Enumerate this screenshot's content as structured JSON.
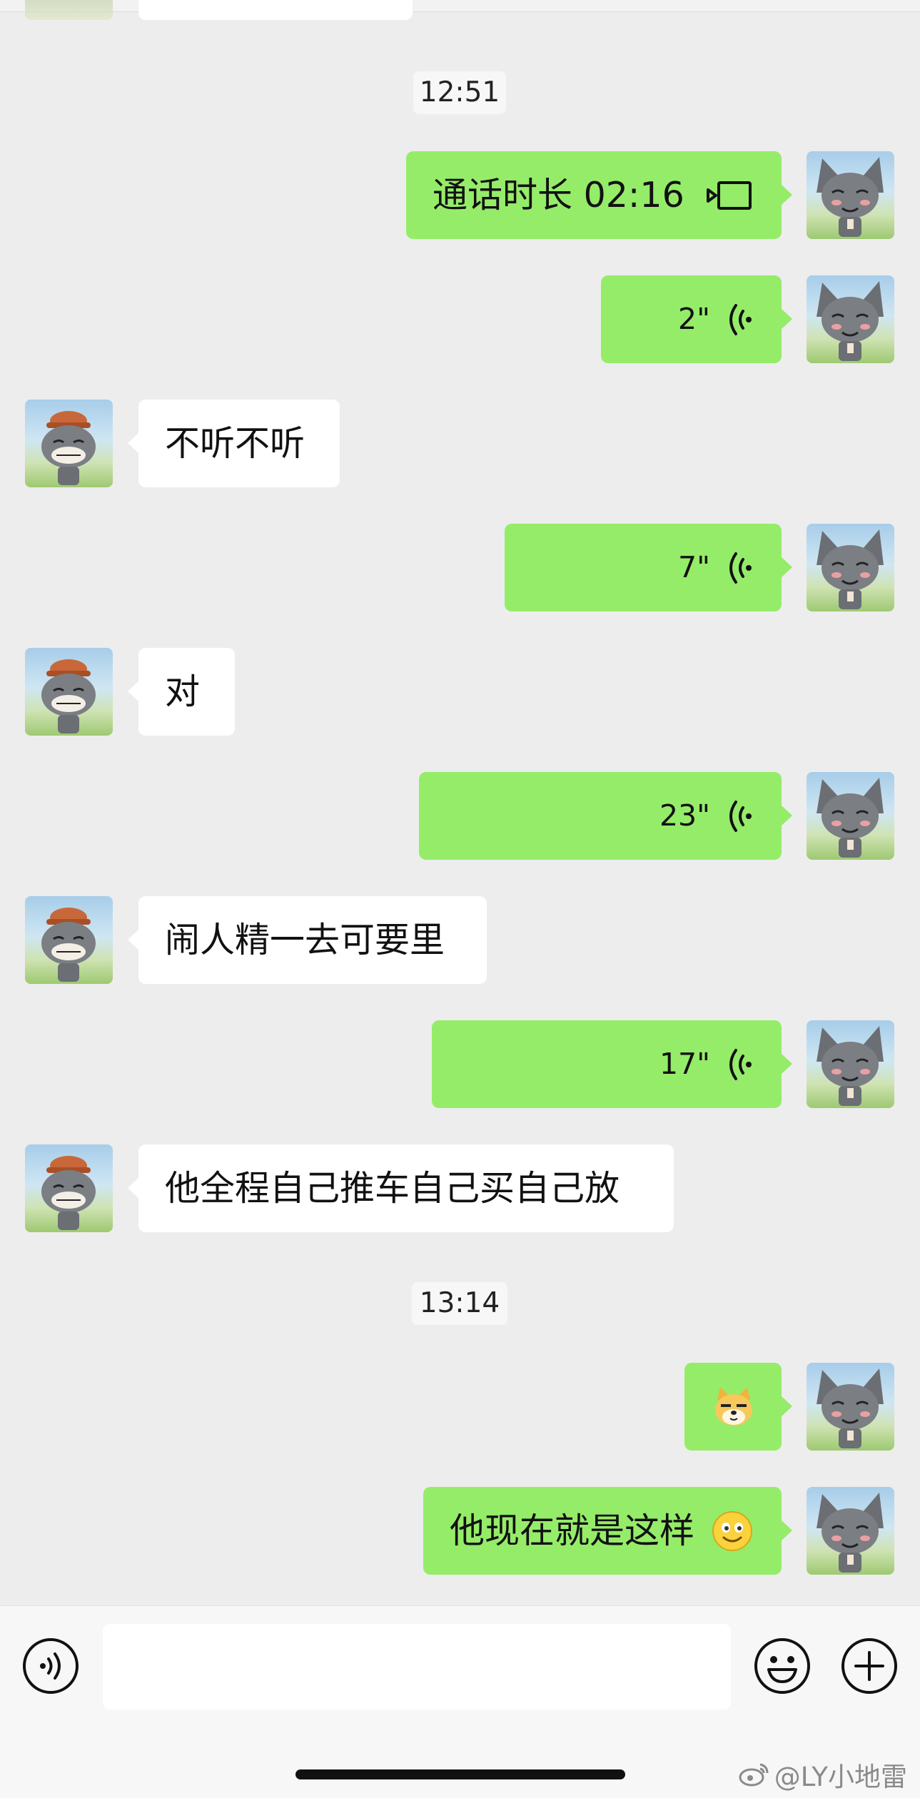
{
  "chat": {
    "timestamps": [
      "12:51",
      "13:14"
    ],
    "call": {
      "label": "通话时长 02:16",
      "icon": "video-call-icon"
    },
    "voice_messages": [
      {
        "duration": "2\""
      },
      {
        "duration": "7\""
      },
      {
        "duration": "23\""
      },
      {
        "duration": "17\""
      }
    ],
    "incoming": [
      "不听不听",
      "对",
      "闹人精一去可要里",
      "他全程自己推车自己买自己放"
    ],
    "last_outgoing": "他现在就是这样",
    "sticker": "doge-sticker-icon",
    "emoji": "smile-emoji-icon"
  },
  "input_bar": {
    "voice_button_icon": "voice-input-icon",
    "emoji_button_icon": "emoji-icon",
    "more_button_icon": "plus-icon"
  },
  "watermark": "@LY小地雷",
  "colors": {
    "outgoing_bubble": "#95ec69",
    "incoming_bubble": "#ffffff",
    "background": "#ededed"
  }
}
